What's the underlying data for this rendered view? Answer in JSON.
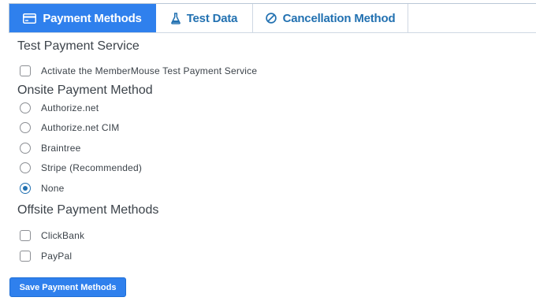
{
  "tabs": [
    {
      "label": "Payment Methods",
      "icon": "credit-card-icon",
      "active": true
    },
    {
      "label": "Test Data",
      "icon": "flask-icon",
      "active": false
    },
    {
      "label": "Cancellation Method",
      "icon": "prohibited-icon",
      "active": false
    }
  ],
  "test_service": {
    "title": "Test Payment Service",
    "activate_label": "Activate the MemberMouse Test Payment Service",
    "activate_checked": false
  },
  "onsite": {
    "title": "Onsite Payment Method",
    "options": [
      {
        "label": "Authorize.net",
        "checked": false
      },
      {
        "label": "Authorize.net CIM",
        "checked": false
      },
      {
        "label": "Braintree",
        "checked": false
      },
      {
        "label": "Stripe (Recommended)",
        "checked": false
      },
      {
        "label": "None",
        "checked": true
      }
    ]
  },
  "offsite": {
    "title": "Offsite Payment Methods",
    "options": [
      {
        "label": "ClickBank",
        "checked": false
      },
      {
        "label": "PayPal",
        "checked": false
      }
    ]
  },
  "save_label": "Save Payment Methods",
  "colors": {
    "accent": "#2f80ed",
    "link": "#2271b1",
    "text": "#3c434a"
  }
}
